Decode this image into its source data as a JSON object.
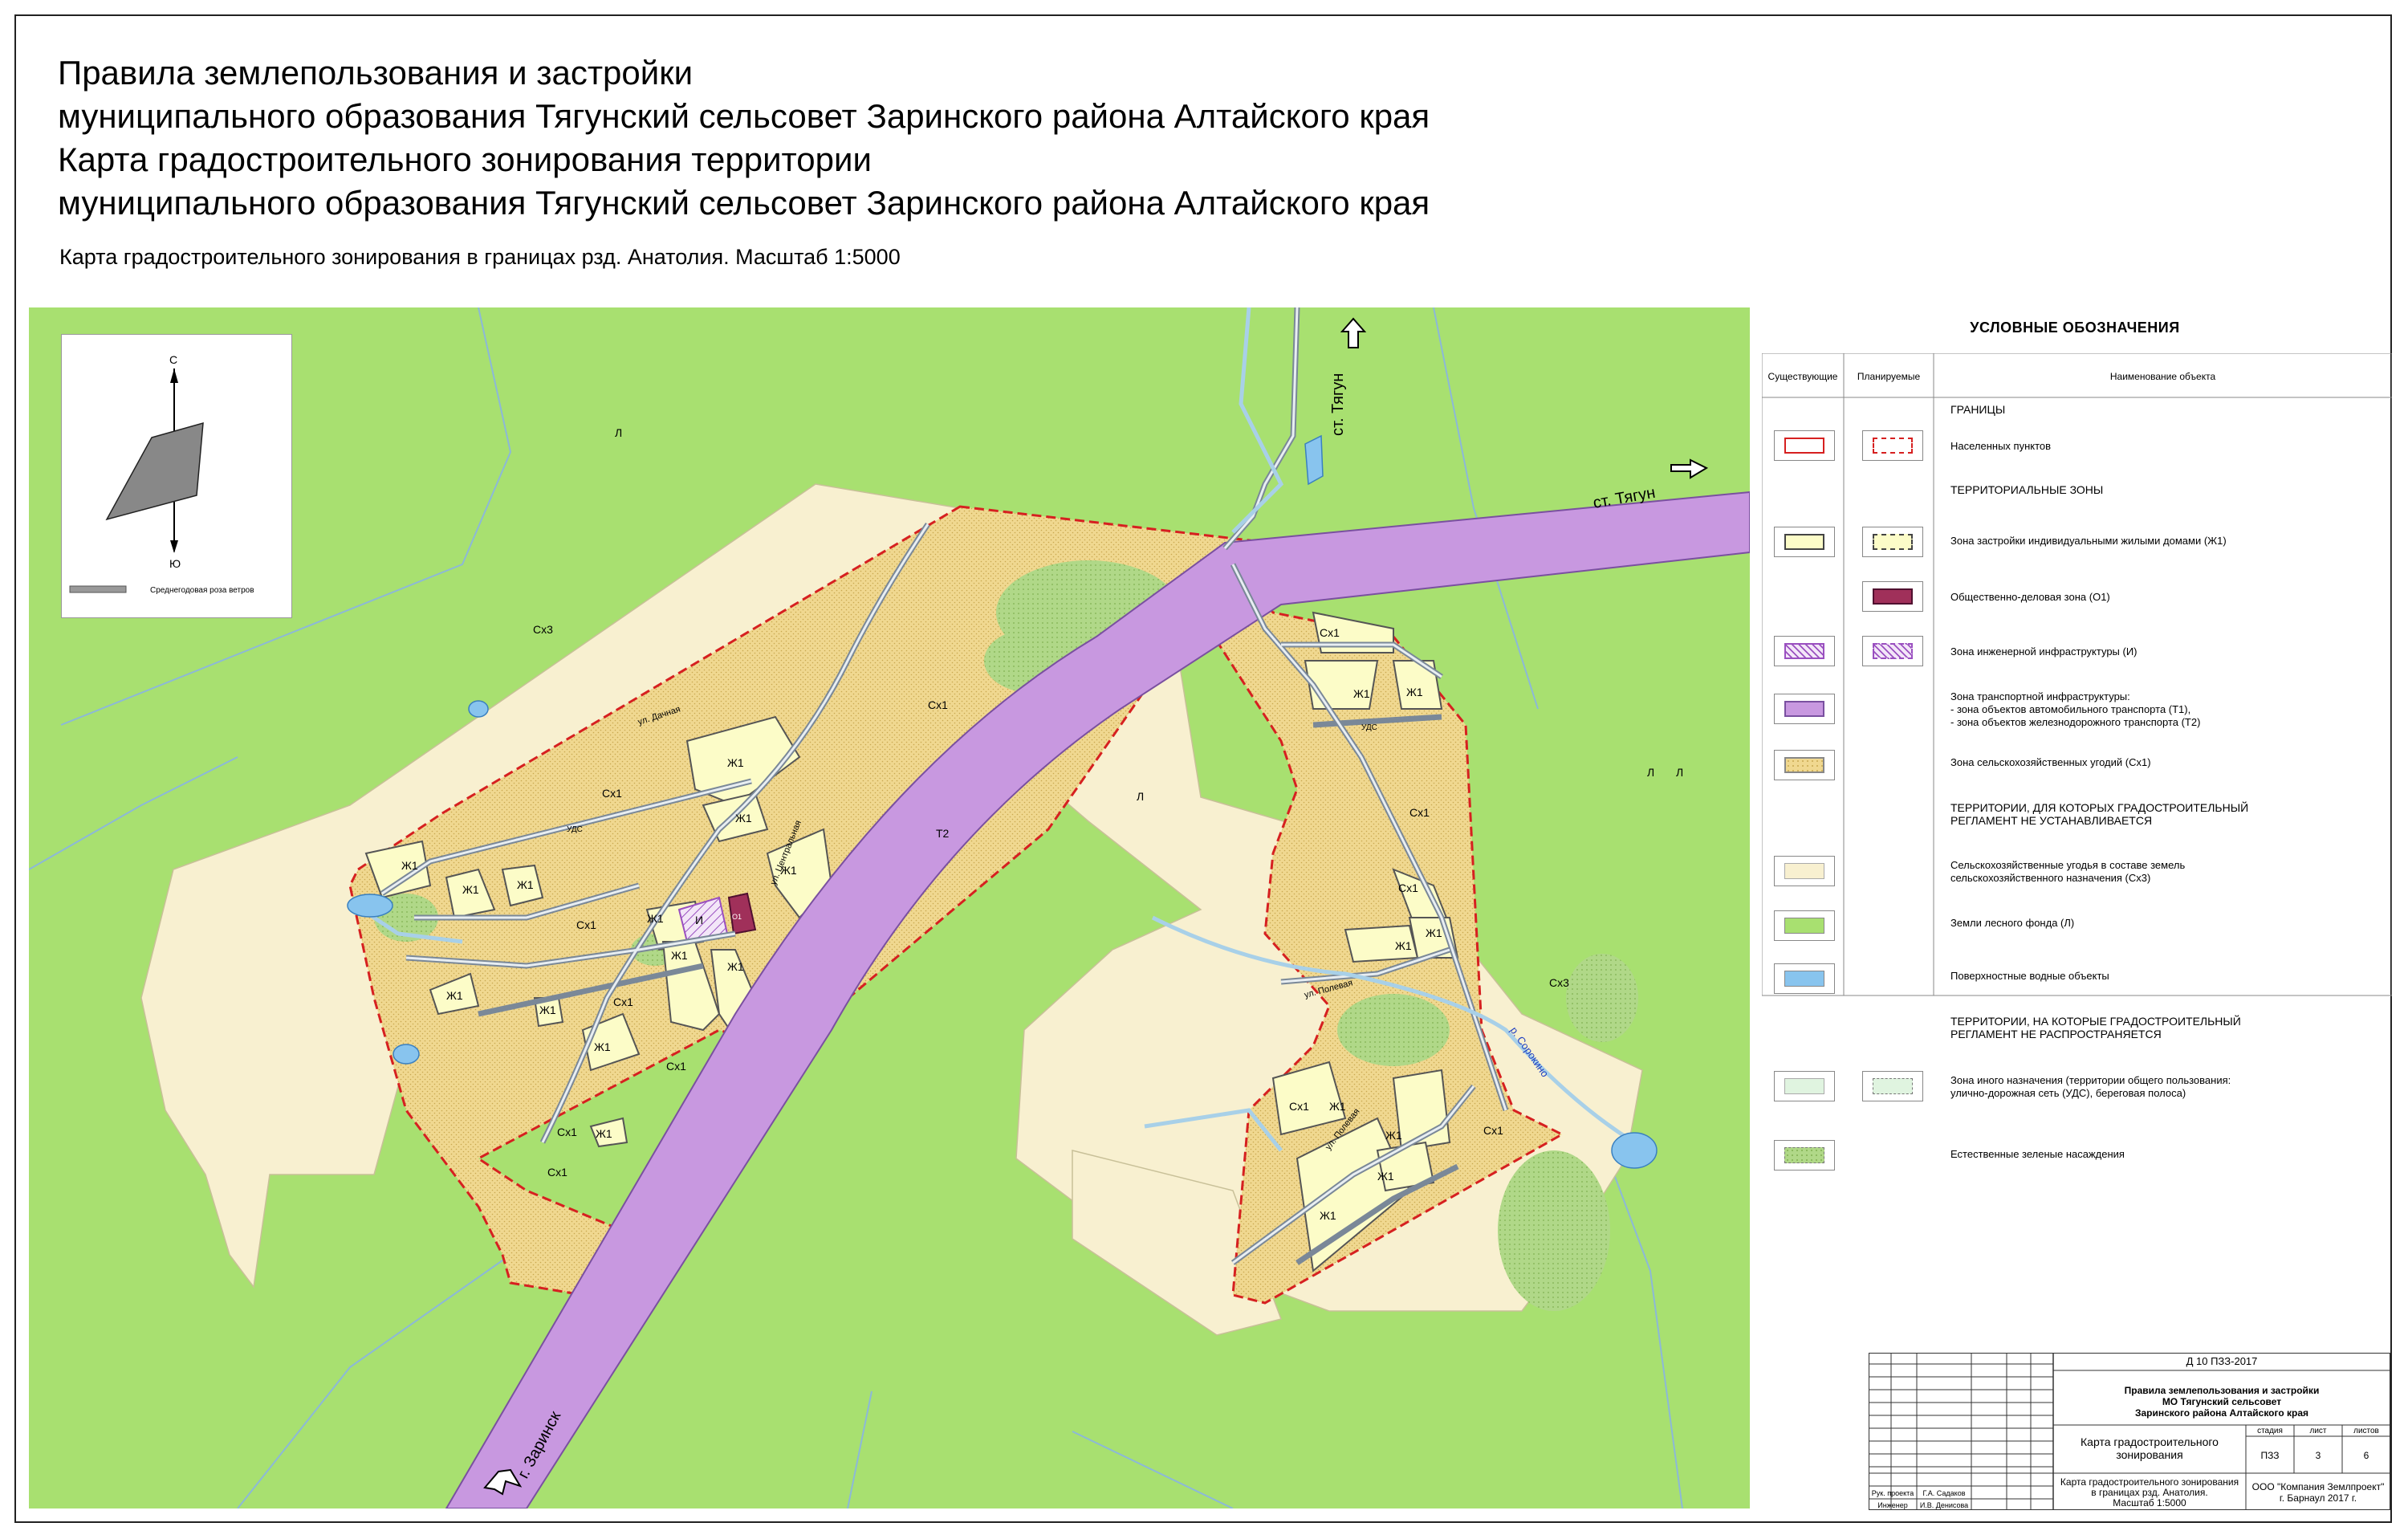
{
  "header": {
    "title_lines": [
      "Правила землепользования и застройки",
      "муниципального образования Тягунский сельсовет Заринского района Алтайского края",
      "Карта градостроительного зонирования территории",
      "муниципального образования Тягунский сельсовет Заринского района Алтайского края"
    ],
    "subtitle": "Карта градостроительного зонирования в границах рзд. Анатолия. Масштаб 1:5000"
  },
  "north_arrow": {
    "north_letter": "С",
    "south_letter": "Ю",
    "caption": "Среднегодовая роза ветров"
  },
  "map": {
    "road_labels": {
      "north": "ст. Тягун",
      "east": "ст. Тягун",
      "south": "г. Заринск"
    },
    "street_labels": [
      "ул. Дачная",
      "ул. Центральная",
      "ул. Полевая",
      "ул. Полевая"
    ],
    "river_label": "р. Сорокино",
    "udc_labels": [
      "УДС",
      "УДС"
    ],
    "zone_labels": {
      "forest": "Л",
      "agri": "Сх1",
      "agri3": "Сх3",
      "residential": "Ж1",
      "public": "О1",
      "infra": "И",
      "transport": "Т2"
    }
  },
  "legend": {
    "title": "УСЛОВНЫЕ ОБОЗНАЧЕНИЯ",
    "columns": [
      "Существующие",
      "Планируемые",
      "Наименование объекта"
    ],
    "sections": {
      "borders": "ГРАНИЦЫ",
      "zones": "ТЕРРИТОРИАЛЬНЫЕ ЗОНЫ",
      "no_reg": [
        "ТЕРРИТОРИИ, ДЛЯ КОТОРЫХ ГРАДОСТРОИТЕЛЬНЫЙ",
        "РЕГЛАМЕНТ НЕ УСТАНАВЛИВАЕТСЯ"
      ],
      "not_apply": [
        "ТЕРРИТОРИИ, НА КОТОРЫЕ ГРАДОСТРОИТЕЛЬНЫЙ",
        "РЕГЛАМЕНТ НЕ РАСПРОСТРАНЯЕТСЯ"
      ]
    },
    "items": {
      "settlements": "Населенных пунктов",
      "zh1": "Зона застройки индивидуальными жилыми домами (Ж1)",
      "o1": "Общественно-деловая зона (О1)",
      "infra": "Зона инженерной инфраструктуры (И)",
      "transport": [
        "Зона транспортной инфраструктуры:",
        "- зона объектов автомобильного транспорта (Т1),",
        "- зона объектов железнодорожного транспорта (Т2)"
      ],
      "sx1": "Зона сельскохозяйственных угодий  (Сх1)",
      "sx3": [
        "Сельскохозяйственные угодья в составе земель",
        "сельскохозяйственного назначения (Сх3)"
      ],
      "forest": "Земли лесного фонда (Л)",
      "water": "Поверхностные водные объекты",
      "other": [
        "Зона иного назначения (территории общего пользования:",
        "улично-дорожная сеть (УДС), береговая полоса)"
      ],
      "green": "Естественные зеленые насаждения"
    }
  },
  "stamp": {
    "doc_code": "Д 10 ПЗЗ-2017",
    "project": [
      "Правила землепользования и застройки",
      "МО Тягунский сельсовет",
      "Заринского района Алтайского края"
    ],
    "sheet_title": [
      "Карта градостроительного",
      "зонирования"
    ],
    "headers": [
      "стадия",
      "лист",
      "листов"
    ],
    "values": [
      "ПЗЗ",
      "3",
      "6"
    ],
    "map_title": [
      "Карта градостроительного зонирования",
      "в границах рзд. Анатолия.",
      "Масштаб 1:5000"
    ],
    "company": [
      "ООО \"Компания Землпроект\"",
      "г. Барнаул 2017 г."
    ],
    "people": [
      {
        "role": "Рук. проекта",
        "name": "Г.А. Садаков"
      },
      {
        "role": "Инженер",
        "name": "И.В. Денисова"
      }
    ]
  },
  "colors": {
    "forest": "#a8e070",
    "agri3": "#f8f0d0",
    "agri1": "#f0d890",
    "residential": "#fcfcc8",
    "transport": "#c898e0",
    "public": "#a0305a",
    "water": "#88c4ee",
    "border_red": "#d62020",
    "green_spots": "#98c870"
  }
}
